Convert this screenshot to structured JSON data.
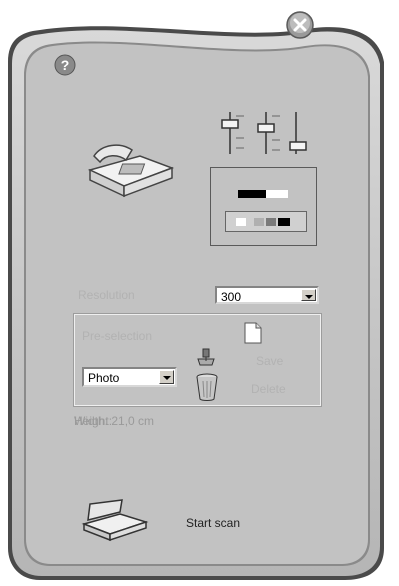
{
  "window": {
    "help_icon": "question-mark-icon",
    "close_icon": "close-x-icon"
  },
  "device": {
    "icon": "fax-machine-icon"
  },
  "adjust": {
    "icon": "sliders-icon",
    "contrast_icon": "contrast-bar-icon",
    "grayscale_icon": "grayscale-bar-icon"
  },
  "resolution": {
    "label": "Resolution",
    "value": "300"
  },
  "preselection": {
    "label": "Pre-selection",
    "value": "Photo",
    "new_icon": "blank-page-icon",
    "save_icon": "scanner-save-icon",
    "save_label": "Save",
    "delete_icon": "trash-can-icon",
    "delete_label": "Delete"
  },
  "size": {
    "width_text": "Width: 21,0 cm",
    "height_text": "Height:"
  },
  "scan": {
    "icon": "flatbed-scanner-icon",
    "label": "Start scan"
  }
}
